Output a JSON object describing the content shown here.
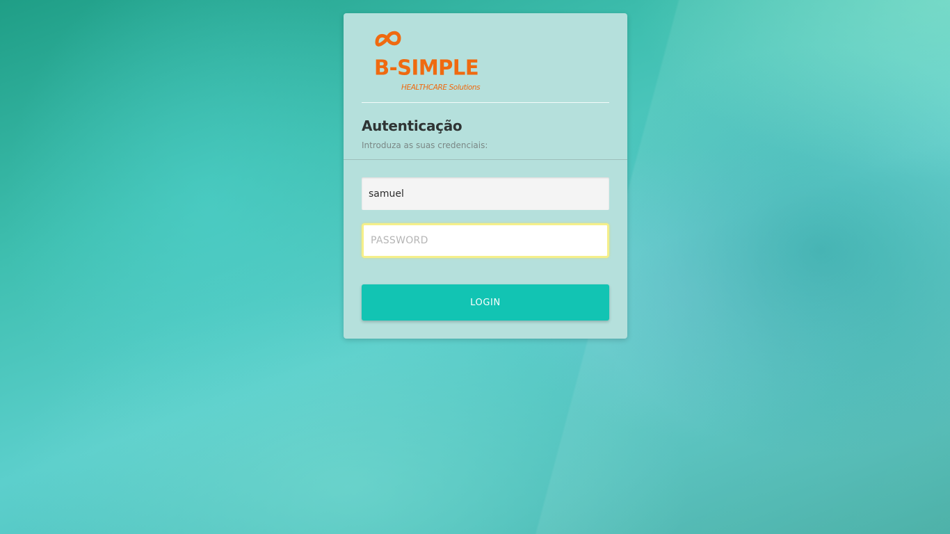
{
  "brand": {
    "logo_text": "B-SIMPLE",
    "logo_subtitle": "HEALTHCARE Solutions",
    "accent_color": "#ef6a10"
  },
  "login": {
    "title": "Autenticação",
    "subtitle": "Introduza as suas credenciais:",
    "username_value": "samuel",
    "username_placeholder": "",
    "password_placeholder": "PASSWORD",
    "password_value": "",
    "submit_label": "LOGIN",
    "button_color": "#12c4b3"
  }
}
